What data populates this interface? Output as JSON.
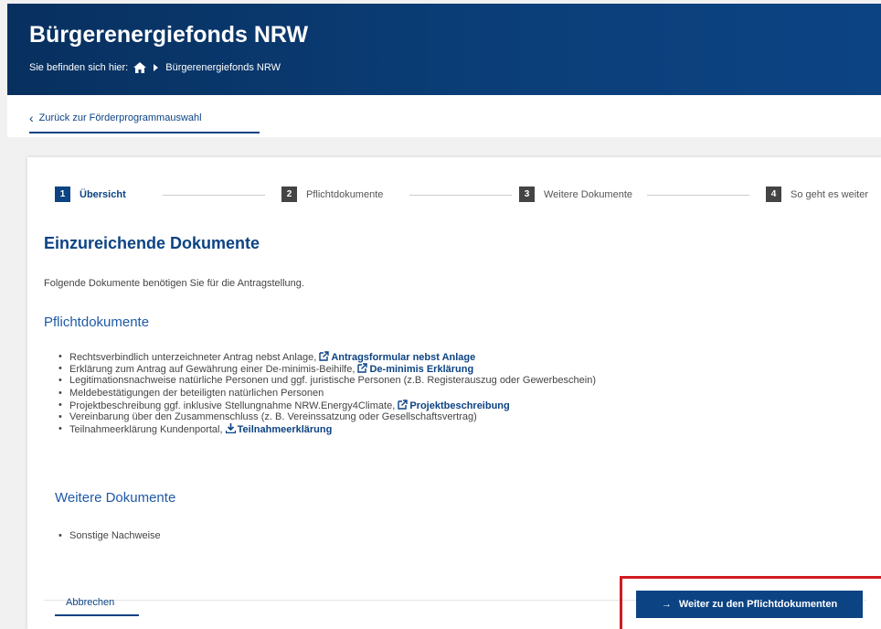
{
  "header": {
    "title": "Bürgerenergiefonds NRW",
    "breadcrumb_prefix": "Sie befinden sich hier:",
    "breadcrumb_current": "Bürgerenergiefonds NRW"
  },
  "back_link": {
    "label": "Zurück zur Förderprogrammauswahl"
  },
  "stepper": [
    {
      "num": "1",
      "label": "Übersicht"
    },
    {
      "num": "2",
      "label": "Pflichtdokumente"
    },
    {
      "num": "3",
      "label": "Weitere Dokumente"
    },
    {
      "num": "4",
      "label": "So geht es weiter"
    }
  ],
  "main": {
    "heading": "Einzureichende Dokumente",
    "intro": "Folgende Dokumente benötigen Sie für die Antragstellung.",
    "section1_title": "Pflichtdokumente",
    "section1_items": [
      {
        "text": "Rechtsverbindlich unterzeichneter Antrag nebst Anlage,",
        "link": "Antragsformular nebst Anlage"
      },
      {
        "text": "Erklärung zum Antrag auf Gewährung einer De-minimis-Beihilfe,",
        "link": "De-minimis Erklärung"
      },
      {
        "text": "Legitimationsnachweise natürliche Personen und ggf. juristische Personen (z.B. Registerauszug oder Gewerbeschein)"
      },
      {
        "text": "Meldebestätigungen der beteiligten natürlichen Personen"
      },
      {
        "text": "Projektbeschreibung ggf. inklusive Stellungnahme NRW.Energy4Climate,",
        "link": "Projektbeschreibung"
      },
      {
        "text": "Vereinbarung über den Zusammenschluss (z. B. Vereinssatzung oder Gesellschaftsvertrag)"
      },
      {
        "text": "Teilnahmeerklärung Kundenportal,",
        "link": "Teilnahmeerklärung"
      }
    ],
    "section2_title": "Weitere Dokumente",
    "section2_items": [
      "Sonstige Nachweise"
    ]
  },
  "footer": {
    "cancel_label": "Abbrechen",
    "next_label": "Weiter zu den Pflichtdokumenten"
  },
  "colors": {
    "brand": "#0c4383",
    "highlight": "#d11a1f"
  }
}
